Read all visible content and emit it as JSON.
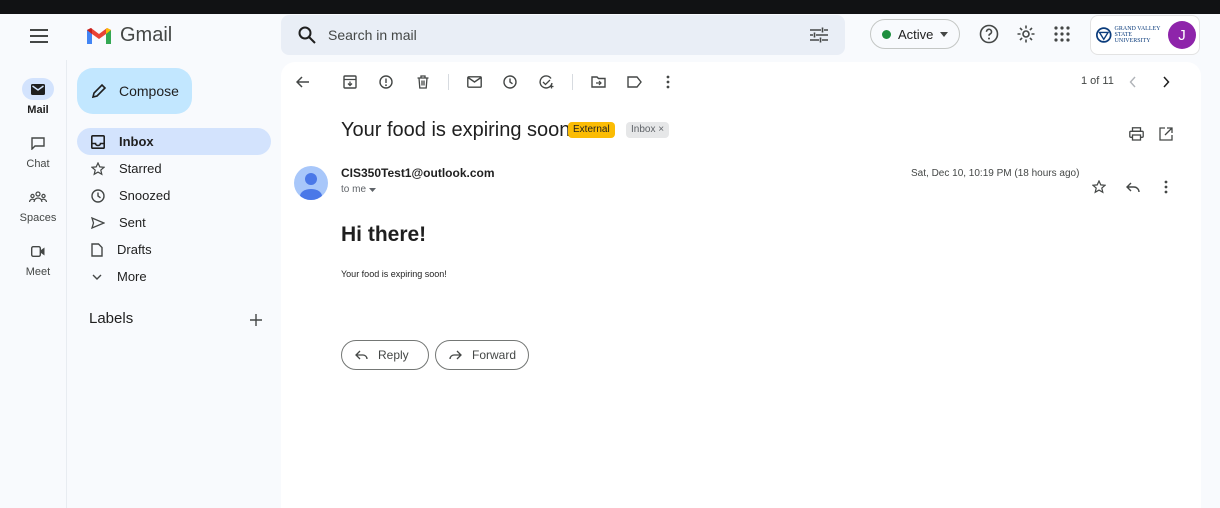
{
  "app": {
    "name": "Gmail"
  },
  "search": {
    "placeholder": "Search in mail"
  },
  "status": {
    "label": "Active",
    "color": "#1e8e3e"
  },
  "account": {
    "initial": "J",
    "org_logo": "Grand Valley State University"
  },
  "rail": [
    {
      "label": "Mail",
      "icon": "mail-icon",
      "selected": true
    },
    {
      "label": "Chat",
      "icon": "chat-icon"
    },
    {
      "label": "Spaces",
      "icon": "spaces-icon"
    },
    {
      "label": "Meet",
      "icon": "meet-icon"
    }
  ],
  "sidebar": {
    "compose_label": "Compose",
    "items": [
      {
        "label": "Inbox",
        "icon": "inbox-icon",
        "selected": true
      },
      {
        "label": "Starred",
        "icon": "star-icon"
      },
      {
        "label": "Snoozed",
        "icon": "clock-icon"
      },
      {
        "label": "Sent",
        "icon": "send-icon"
      },
      {
        "label": "Drafts",
        "icon": "draft-icon"
      },
      {
        "label": "More",
        "icon": "chevron-down-icon"
      }
    ],
    "labels_heading": "Labels"
  },
  "toolbar": {
    "pager": "1 of 11"
  },
  "email": {
    "subject": "Your food is expiring soon!",
    "tags": {
      "external": "External",
      "inbox": "Inbox ×"
    },
    "sender": "CIS350Test1@outlook.com",
    "to": "to me",
    "date": "Sat, Dec 10, 10:19 PM (18 hours ago)",
    "greeting": "Hi there!",
    "body": "Your food is expiring soon!"
  },
  "actions": {
    "reply": "Reply",
    "forward": "Forward"
  },
  "colors": {
    "compose": "#c2e7ff",
    "selected": "#d3e3fd",
    "external_tag": "#fbbc04",
    "avatar": "#8e24aa"
  }
}
